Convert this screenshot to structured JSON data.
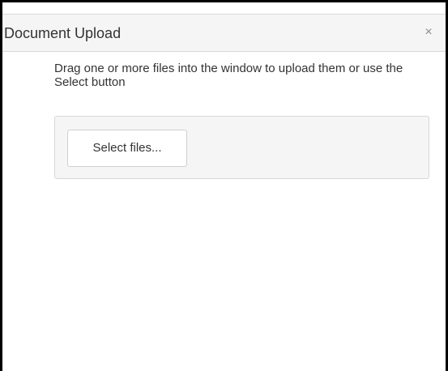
{
  "window": {
    "title": "Document Upload",
    "close_icon": "close-icon",
    "close_glyph": "×"
  },
  "upload": {
    "instructions": "Drag one or more files into the window to upload them or use the Select button",
    "select_button_label": "Select files..."
  },
  "colors": {
    "titlebar_bg": "#f5f5f5",
    "dropzone_bg": "#f5f5f5",
    "border": "#d8d8d8",
    "text": "#333333"
  }
}
